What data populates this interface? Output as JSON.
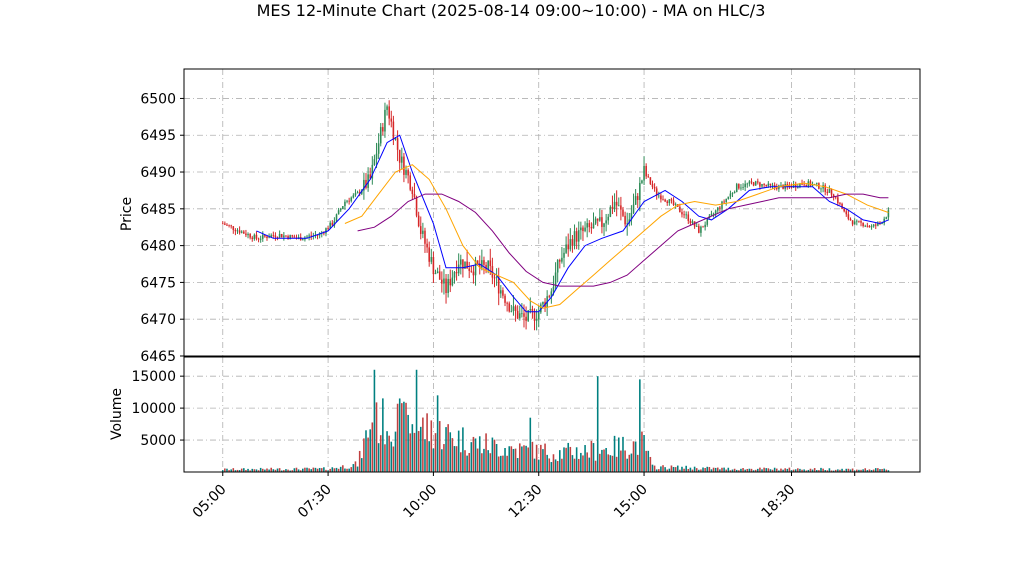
{
  "chart_data": {
    "type": "candlestick",
    "title": "MES 12-Minute Chart (2025-08-14 09:00~10:00) - MA on HLC/3",
    "price_panel": {
      "ylabel": "Price",
      "ylim": [
        6465,
        6504
      ],
      "yticks": [
        6465,
        6470,
        6475,
        6480,
        6485,
        6490,
        6495,
        6500
      ],
      "grid": true
    },
    "volume_panel": {
      "ylabel": "Volume",
      "ylim": [
        0,
        18000
      ],
      "yticks": [
        5000,
        10000,
        15000
      ],
      "grid": true
    },
    "x_axis": {
      "tick_labels": [
        "05:00",
        "07:30",
        "10:00",
        "12:30",
        "15:00",
        "18:30"
      ],
      "tick_times_hours": [
        5.0,
        7.5,
        10.0,
        12.5,
        15.0,
        18.5,
        20.0
      ],
      "range_hours": [
        4.2,
        20.8
      ]
    },
    "colors": {
      "up": "#2e8b57",
      "down": "#d62728",
      "ma_fast": "#0000ff",
      "ma_mid": "#ffa500",
      "ma_slow": "#800080",
      "vol_a": "#008080",
      "vol_b": "#c04040"
    },
    "price_path_keypoints": [
      [
        5.0,
        6483.0
      ],
      [
        5.4,
        6482.0
      ],
      [
        5.8,
        6481.0
      ],
      [
        6.3,
        6481.5
      ],
      [
        6.8,
        6481.0
      ],
      [
        7.3,
        6481.5
      ],
      [
        7.6,
        6483.0
      ],
      [
        7.9,
        6486.0
      ],
      [
        8.2,
        6487.0
      ],
      [
        8.5,
        6489.0
      ],
      [
        8.7,
        6494.0
      ],
      [
        8.9,
        6499.0
      ],
      [
        9.2,
        6492.0
      ],
      [
        9.5,
        6488.0
      ],
      [
        9.7,
        6482.0
      ],
      [
        10.0,
        6477.0
      ],
      [
        10.3,
        6474.0
      ],
      [
        10.6,
        6478.0
      ],
      [
        10.9,
        6477.0
      ],
      [
        11.3,
        6477.0
      ],
      [
        11.6,
        6474.0
      ],
      [
        11.9,
        6471.0
      ],
      [
        12.2,
        6470.0
      ],
      [
        12.5,
        6471.0
      ],
      [
        12.8,
        6474.0
      ],
      [
        13.0,
        6478.0
      ],
      [
        13.3,
        6481.0
      ],
      [
        13.6,
        6482.0
      ],
      [
        14.0,
        6483.0
      ],
      [
        14.3,
        6486.0
      ],
      [
        14.6,
        6483.0
      ],
      [
        14.8,
        6486.0
      ],
      [
        15.0,
        6490.0
      ],
      [
        15.3,
        6487.0
      ],
      [
        15.6,
        6486.0
      ],
      [
        16.0,
        6484.0
      ],
      [
        16.3,
        6482.0
      ],
      [
        16.6,
        6484.0
      ],
      [
        16.9,
        6486.0
      ],
      [
        17.2,
        6488.0
      ],
      [
        17.6,
        6488.5
      ],
      [
        18.0,
        6488.0
      ],
      [
        18.4,
        6488.0
      ],
      [
        18.8,
        6488.5
      ],
      [
        19.2,
        6488.0
      ],
      [
        19.5,
        6487.0
      ],
      [
        19.8,
        6484.0
      ],
      [
        20.0,
        6483.0
      ],
      [
        20.2,
        6483.0
      ],
      [
        20.4,
        6482.5
      ],
      [
        20.6,
        6483.0
      ],
      [
        20.8,
        6484.5
      ]
    ],
    "volume_spikes": [
      [
        8.6,
        16000
      ],
      [
        9.6,
        16000
      ],
      [
        9.3,
        11000
      ],
      [
        10.1,
        12000
      ],
      [
        13.9,
        15000
      ],
      [
        14.9,
        14500
      ],
      [
        12.3,
        8500
      ]
    ],
    "volume_profile_keypoints": [
      [
        5.0,
        400
      ],
      [
        7.5,
        500
      ],
      [
        8.2,
        1200
      ],
      [
        8.5,
        7500
      ],
      [
        9.0,
        8000
      ],
      [
        10.0,
        6500
      ],
      [
        11.0,
        4500
      ],
      [
        12.0,
        3500
      ],
      [
        13.0,
        3000
      ],
      [
        14.0,
        3500
      ],
      [
        15.0,
        4500
      ],
      [
        15.2,
        800
      ],
      [
        17.0,
        500
      ],
      [
        20.8,
        400
      ]
    ],
    "ma_fast_keypoints": [
      [
        5.8,
        6482.0
      ],
      [
        6.2,
        6481.0
      ],
      [
        7.0,
        6481.0
      ],
      [
        7.5,
        6482.0
      ],
      [
        8.0,
        6485.0
      ],
      [
        8.5,
        6489.0
      ],
      [
        8.9,
        6494.0
      ],
      [
        9.2,
        6495.0
      ],
      [
        9.5,
        6490.0
      ],
      [
        10.0,
        6483.0
      ],
      [
        10.3,
        6477.0
      ],
      [
        10.7,
        6477.0
      ],
      [
        11.1,
        6477.5
      ],
      [
        11.5,
        6476.0
      ],
      [
        11.9,
        6473.0
      ],
      [
        12.2,
        6471.0
      ],
      [
        12.5,
        6471.0
      ],
      [
        12.8,
        6473.0
      ],
      [
        13.2,
        6477.0
      ],
      [
        13.6,
        6480.0
      ],
      [
        14.0,
        6481.0
      ],
      [
        14.5,
        6482.0
      ],
      [
        15.0,
        6486.0
      ],
      [
        15.5,
        6487.5
      ],
      [
        15.9,
        6486.0
      ],
      [
        16.3,
        6484.0
      ],
      [
        16.6,
        6483.5
      ],
      [
        17.0,
        6485.0
      ],
      [
        17.5,
        6487.5
      ],
      [
        18.0,
        6488.0
      ],
      [
        18.5,
        6488.0
      ],
      [
        19.0,
        6488.0
      ],
      [
        19.4,
        6486.0
      ],
      [
        19.8,
        6485.0
      ],
      [
        20.2,
        6483.5
      ],
      [
        20.6,
        6483.0
      ],
      [
        20.8,
        6483.5
      ]
    ],
    "ma_mid_keypoints": [
      [
        7.9,
        6483.0
      ],
      [
        8.3,
        6484.0
      ],
      [
        8.7,
        6487.0
      ],
      [
        9.1,
        6490.0
      ],
      [
        9.5,
        6491.0
      ],
      [
        9.9,
        6489.0
      ],
      [
        10.3,
        6485.0
      ],
      [
        10.7,
        6480.0
      ],
      [
        11.1,
        6477.0
      ],
      [
        11.5,
        6476.0
      ],
      [
        11.9,
        6475.0
      ],
      [
        12.3,
        6472.5
      ],
      [
        12.6,
        6471.5
      ],
      [
        13.0,
        6472.0
      ],
      [
        13.4,
        6474.0
      ],
      [
        13.8,
        6476.0
      ],
      [
        14.2,
        6478.0
      ],
      [
        14.6,
        6480.0
      ],
      [
        15.0,
        6482.0
      ],
      [
        15.4,
        6484.0
      ],
      [
        15.8,
        6485.5
      ],
      [
        16.2,
        6486.0
      ],
      [
        16.7,
        6485.5
      ],
      [
        17.2,
        6486.0
      ],
      [
        17.7,
        6487.0
      ],
      [
        18.2,
        6488.0
      ],
      [
        18.8,
        6488.5
      ],
      [
        19.3,
        6488.0
      ],
      [
        19.8,
        6487.0
      ],
      [
        20.3,
        6485.5
      ],
      [
        20.8,
        6484.5
      ]
    ],
    "ma_slow_keypoints": [
      [
        8.2,
        6482.0
      ],
      [
        8.6,
        6482.5
      ],
      [
        9.0,
        6484.0
      ],
      [
        9.4,
        6486.0
      ],
      [
        9.8,
        6487.0
      ],
      [
        10.2,
        6487.0
      ],
      [
        10.6,
        6486.0
      ],
      [
        11.0,
        6484.5
      ],
      [
        11.4,
        6482.0
      ],
      [
        11.8,
        6479.0
      ],
      [
        12.2,
        6476.5
      ],
      [
        12.6,
        6475.0
      ],
      [
        13.0,
        6474.5
      ],
      [
        13.4,
        6474.5
      ],
      [
        13.8,
        6474.5
      ],
      [
        14.2,
        6475.0
      ],
      [
        14.6,
        6476.0
      ],
      [
        15.0,
        6478.0
      ],
      [
        15.4,
        6480.0
      ],
      [
        15.8,
        6482.0
      ],
      [
        16.2,
        6483.0
      ],
      [
        16.6,
        6484.0
      ],
      [
        17.0,
        6485.0
      ],
      [
        17.4,
        6485.5
      ],
      [
        17.8,
        6486.0
      ],
      [
        18.2,
        6486.5
      ],
      [
        18.6,
        6486.5
      ],
      [
        19.0,
        6486.5
      ],
      [
        19.4,
        6486.5
      ],
      [
        19.8,
        6487.0
      ],
      [
        20.2,
        6487.0
      ],
      [
        20.6,
        6486.5
      ],
      [
        20.8,
        6486.5
      ]
    ]
  }
}
